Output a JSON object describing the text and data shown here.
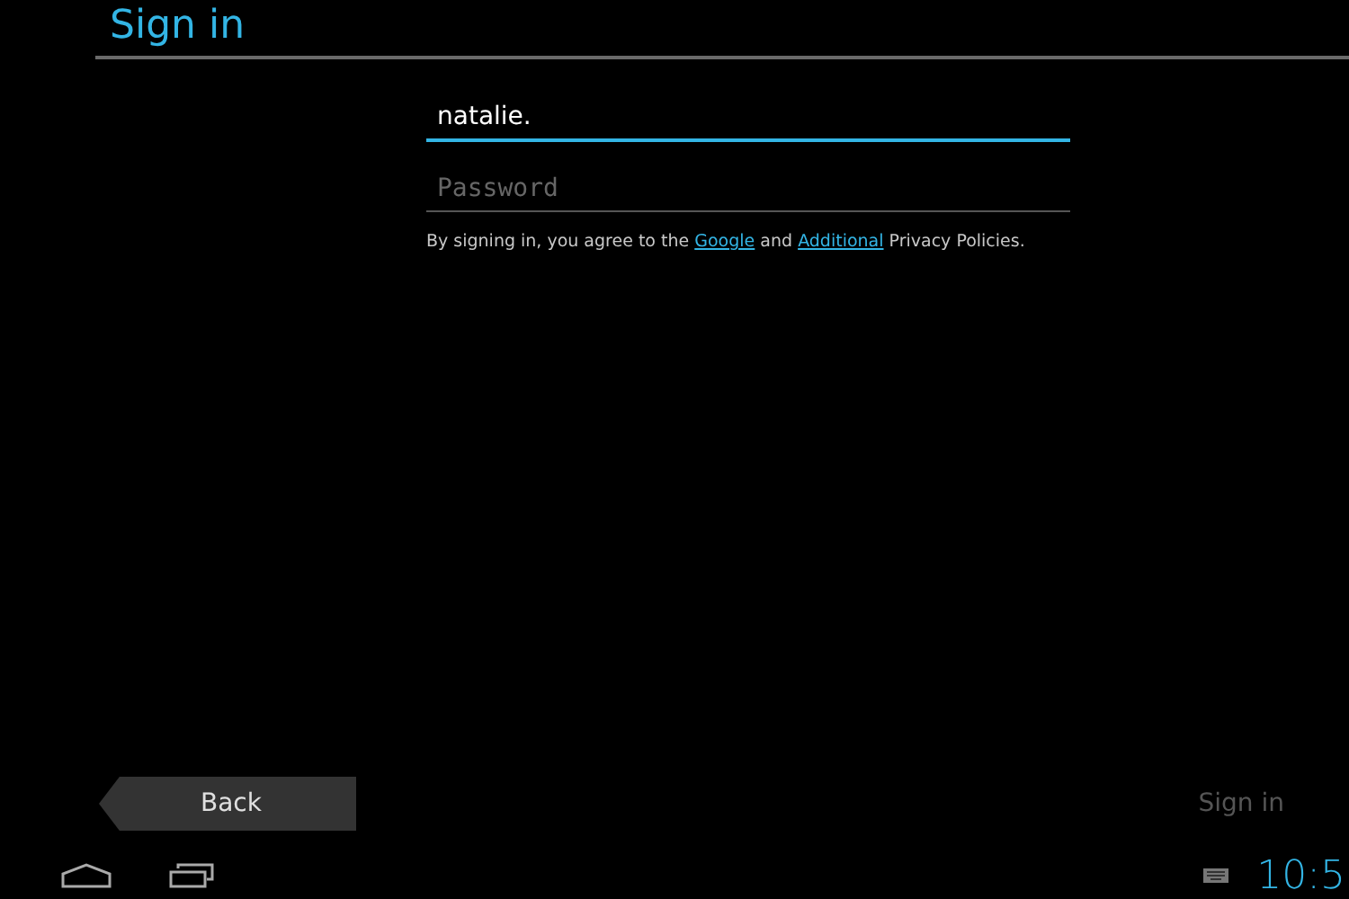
{
  "header": {
    "title": "Sign in"
  },
  "form": {
    "email": {
      "value": "natalie.",
      "focused": true
    },
    "password": {
      "placeholder": "Password",
      "focused": false
    },
    "terms": {
      "before": "By signing in, you agree to the ",
      "link1": "Google",
      "middle": " and ",
      "link2": "Additional",
      "after": " Privacy Policies."
    }
  },
  "footer": {
    "back": {
      "label": "Back"
    },
    "sign_in": {
      "label": "Sign in",
      "disabled": true
    }
  },
  "navigation_bar": {
    "clock": "10:5"
  }
}
